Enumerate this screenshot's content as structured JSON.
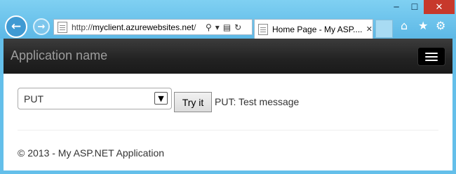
{
  "browser": {
    "window_controls": {
      "minimize": "─",
      "maximize": "☐",
      "close": "✕"
    },
    "nav": {
      "back_icon": "←",
      "forward_icon": "→"
    },
    "address": {
      "scheme": "http://",
      "host": "myclient.azurewebsites.net",
      "suffix": "/",
      "icons": [
        "search-icon",
        "dropdown-icon",
        "compat-icon",
        "refresh-icon"
      ]
    },
    "tab": {
      "title": "Home Page - My ASP....",
      "close": "✕"
    },
    "toolbar_icons": [
      "home-icon",
      "star-icon",
      "gear-icon"
    ]
  },
  "app": {
    "navbar": {
      "brand": "Application name"
    },
    "form": {
      "method_selected": "PUT",
      "try_label": "Try it",
      "result_text": "PUT: Test message"
    },
    "footer": {
      "text": "© 2013 - My ASP.NET Application"
    }
  },
  "colors": {
    "chrome": "#64bfea",
    "navbar": "#222222",
    "close_button": "#c7392b"
  }
}
